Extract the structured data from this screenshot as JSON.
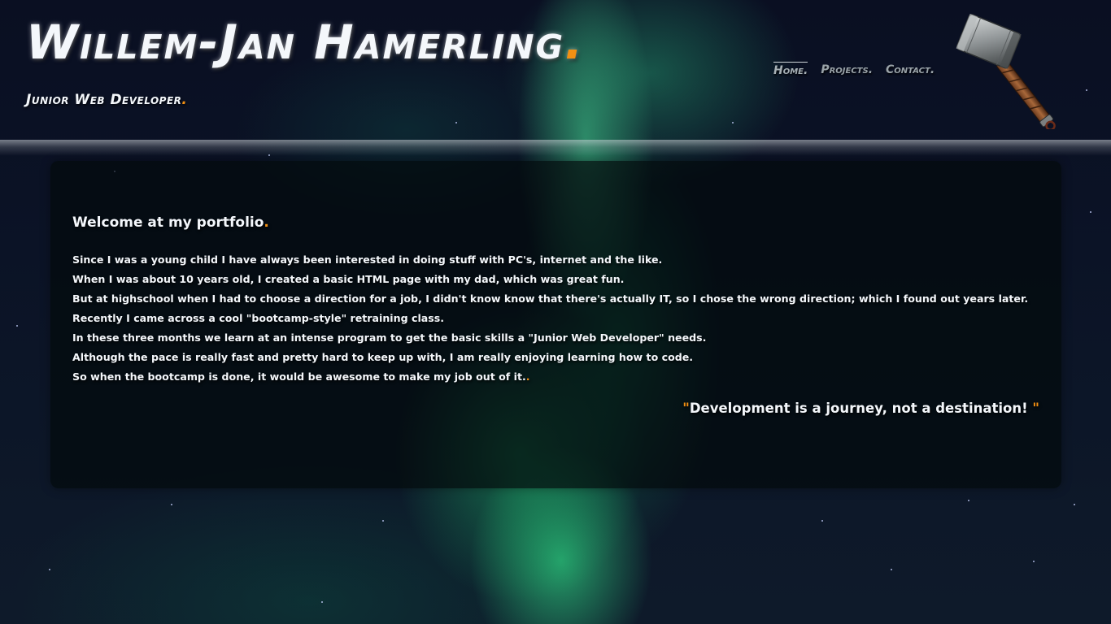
{
  "header": {
    "title": "Willem-Jan Hamerling",
    "title_dot": ".",
    "subtitle": "Junior Web Developer",
    "subtitle_dot": "."
  },
  "nav": {
    "items": [
      {
        "label": "Home.",
        "active": true
      },
      {
        "label": "Projects.",
        "active": false
      },
      {
        "label": "Contact.",
        "active": false
      }
    ]
  },
  "content": {
    "heading": "Welcome at my portfolio",
    "heading_dot": ".",
    "paragraphs": [
      "Since I was a young child I have always been interested in doing stuff with PC's, internet and the like.",
      "When I was about 10 years old, I created a basic HTML page with my dad, which was great fun.",
      "But at highschool when I had to choose a direction for a job, I didn't know know that there's actually IT, so I chose the wrong direction; which I found out years later.",
      "Recently I came across a cool \"bootcamp-style\" retraining class.",
      "In these three months we learn at an intense program to get the basic skills a \"Junior Web Developer\" needs.",
      "Although the pace is really fast and pretty hard to keep up with, I am really enjoying learning how to code.",
      "So when the bootcamp is done, it would be awesome to make my job out of it."
    ],
    "final_dot": ".",
    "quote_open": "\"",
    "quote": "Development is a journey, not a destination! ",
    "quote_close": "\""
  },
  "icons": {
    "logo": "hammer-icon"
  },
  "colors": {
    "accent": "#f39012",
    "text": "#f4f7fb",
    "nav_text": "#9aa3a8",
    "card_bg": "rgba(3,10,12,0.70)"
  }
}
